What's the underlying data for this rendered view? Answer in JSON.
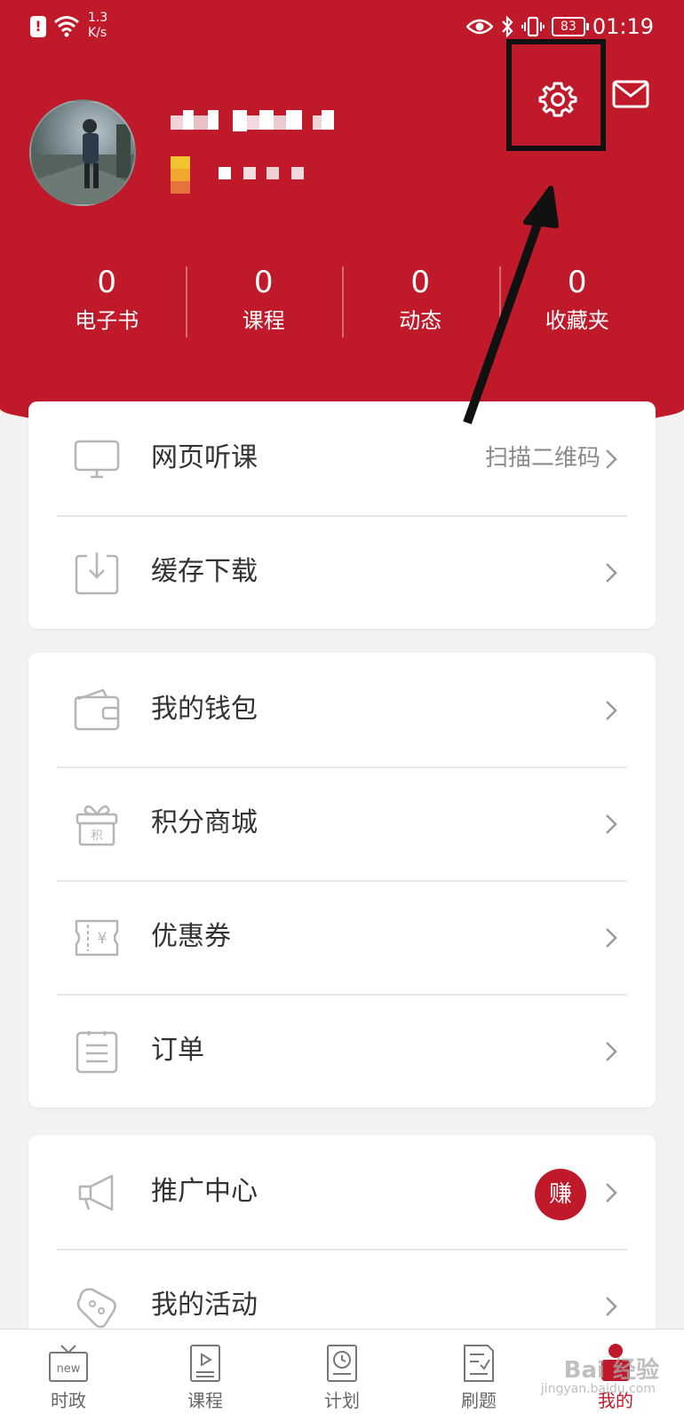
{
  "status_bar": {
    "network_speed_value": "1.3",
    "network_speed_unit": "K/s",
    "battery": "83",
    "time": "01:19"
  },
  "header": {
    "stats": [
      {
        "value": "0",
        "label": "电子书"
      },
      {
        "value": "0",
        "label": "课程"
      },
      {
        "value": "0",
        "label": "动态"
      },
      {
        "value": "0",
        "label": "收藏夹"
      }
    ]
  },
  "menu_group_1": {
    "items": [
      {
        "label": "网页听课",
        "hint": "扫描二维码",
        "icon": "monitor-icon"
      },
      {
        "label": "缓存下载",
        "icon": "download-icon"
      }
    ]
  },
  "menu_group_2": {
    "items": [
      {
        "label": "我的钱包",
        "icon": "wallet-icon"
      },
      {
        "label": "积分商城",
        "icon": "gift-icon",
        "icon_text": "积"
      },
      {
        "label": "优惠券",
        "icon": "coupon-icon",
        "icon_text": "¥"
      },
      {
        "label": "订单",
        "icon": "order-icon"
      }
    ]
  },
  "menu_group_3": {
    "items": [
      {
        "label": "推广中心",
        "badge": "赚",
        "icon": "megaphone-icon"
      },
      {
        "label": "我的活动",
        "icon": "activity-icon"
      }
    ]
  },
  "tab_bar": {
    "tabs": [
      {
        "label": "时政",
        "icon": "news-tv-icon",
        "icon_text": "new"
      },
      {
        "label": "课程",
        "icon": "course-icon"
      },
      {
        "label": "计划",
        "icon": "plan-clock-icon"
      },
      {
        "label": "刷题",
        "icon": "quiz-icon"
      },
      {
        "label": "我的",
        "icon": "profile-icon"
      }
    ],
    "active_index": 4
  },
  "watermark": {
    "text": "Bai 经验",
    "subtext": "jingyan.baidu.com"
  },
  "colors": {
    "brand_red": "#c0192a",
    "background": "#f2f2f2"
  }
}
